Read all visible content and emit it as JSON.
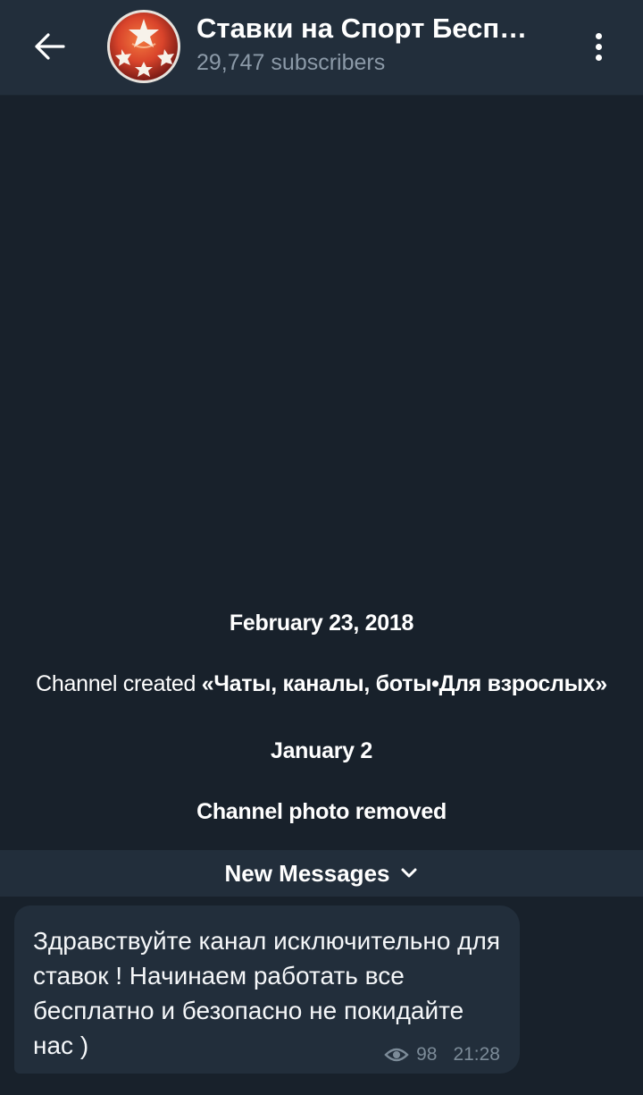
{
  "header": {
    "back_icon": "arrow-left-icon",
    "title": "Ставки на Спорт Бесп…",
    "subscribers": "29,747 subscribers",
    "menu_icon": "more-vertical-icon"
  },
  "service_messages": {
    "date1": "February 23, 2018",
    "created_prefix": "Channel created ",
    "created_name": "«Чаты, каналы, боты•Для взрослых»",
    "date2": "January 2",
    "photo_removed": "Channel photo removed"
  },
  "new_messages": {
    "label": "New Messages",
    "icon": "chevron-down-icon"
  },
  "message": {
    "text": "Здравствуйте канал исключительно для ставок ! Начинаем работать все бесплатно и безопасно не покидайте нас )",
    "views": "98",
    "views_icon": "eye-icon",
    "time": "21:28"
  },
  "colors": {
    "background": "#18212b",
    "header": "#222e3b",
    "bubble": "#222e3b",
    "muted_text": "#8c9aa8"
  }
}
